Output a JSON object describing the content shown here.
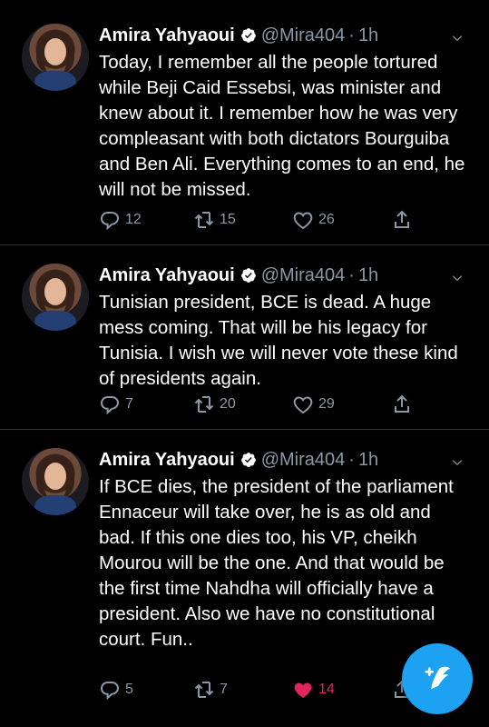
{
  "tweets": [
    {
      "author": {
        "name": "Amira Yahyaoui",
        "handle": "@Mira404",
        "time": "1h"
      },
      "text": "Today, I remember all the people tortured while Beji Caid Essebsi, was minister and knew about it. I remember how he was very compleasant with both dictators Bourguiba and Ben Ali. Everything comes to an end, he will not be missed.",
      "stats": {
        "replies": "12",
        "retweets": "15",
        "likes": "26"
      },
      "liked": false
    },
    {
      "author": {
        "name": "Amira Yahyaoui",
        "handle": "@Mira404",
        "time": "1h"
      },
      "text": "Tunisian president, BCE is dead. A huge mess coming. That will be his legacy for Tunisia. I wish we will never vote these kind of presidents again.",
      "stats": {
        "replies": "7",
        "retweets": "20",
        "likes": "29"
      },
      "liked": false
    },
    {
      "author": {
        "name": "Amira Yahyaoui",
        "handle": "@Mira404",
        "time": "1h"
      },
      "text": "If BCE dies, the president of the parliament Ennaceur will take over, he is as old and bad. If this one dies too, his VP, cheikh Mourou will be the one. And that would be the first time Nahdha will officially have a president.\nAlso we have no constitutional court.\nFun..",
      "stats": {
        "replies": "5",
        "retweets": "7",
        "likes": "14"
      },
      "liked": true
    }
  ],
  "colors": {
    "background": "#000000",
    "muted": "#8b98a5",
    "accent": "#1da1f2",
    "like": "#e0245e"
  },
  "icons": {
    "verified": "verified-badge-icon",
    "reply": "reply-icon",
    "retweet": "retweet-icon",
    "like": "heart-icon",
    "share": "share-icon",
    "compose": "compose-tweet-icon"
  }
}
